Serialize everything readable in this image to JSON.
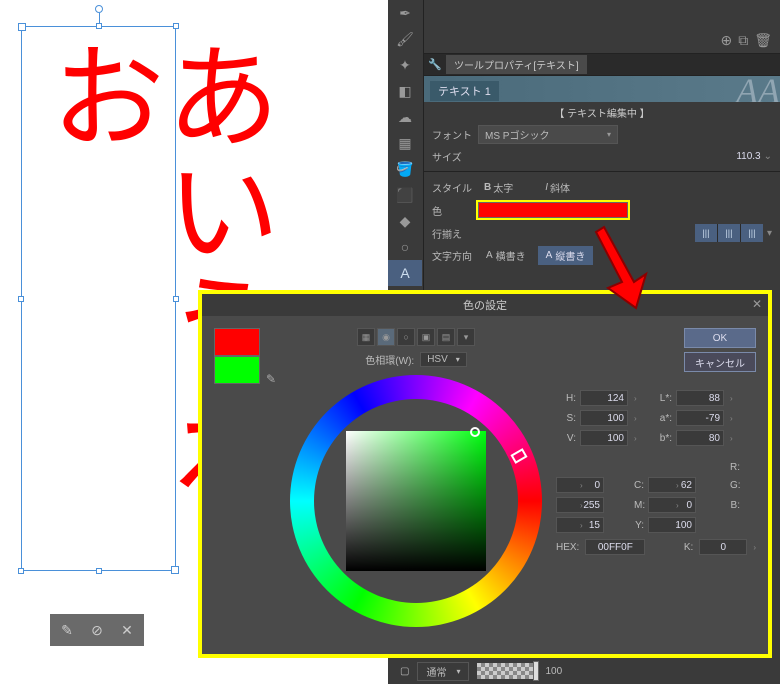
{
  "canvas": {
    "text": "あいうえお"
  },
  "panel": {
    "tab_title": "ツールプロパティ[テキスト]",
    "tool_name": "テキスト 1",
    "editing": "【 テキスト編集中 】",
    "font_label": "フォント",
    "font_value": "MS Pゴシック",
    "size_label": "サイズ",
    "size_value": "110.3",
    "style_label": "スタイル",
    "bold": "太字",
    "italic": "斜体",
    "color_label": "色",
    "align_label": "行揃え",
    "dir_label": "文字方向",
    "horiz": "横書き",
    "vert": "縦書き"
  },
  "dialog": {
    "title": "色の設定",
    "ok": "OK",
    "cancel": "キャンセル",
    "wheel_label": "色相環(W):",
    "mode": "HSV",
    "H": "124",
    "S": "100",
    "V": "100",
    "R": "0",
    "G": "255",
    "B": "15",
    "L": "88",
    "a": "-79",
    "b": "80",
    "C": "62",
    "M": "0",
    "Y": "100",
    "K": "0",
    "hex_label": "HEX:",
    "hex": "00FF0F",
    "labels": {
      "H": "H:",
      "S": "S:",
      "V": "V:",
      "R": "R:",
      "G": "G:",
      "B": "B:",
      "L": "L*:",
      "a": "a*:",
      "b": "b*:",
      "C": "C:",
      "M": "M:",
      "Y": "Y:",
      "K": "K:"
    }
  },
  "bottom": {
    "mode": "通常",
    "opacity": "100"
  }
}
